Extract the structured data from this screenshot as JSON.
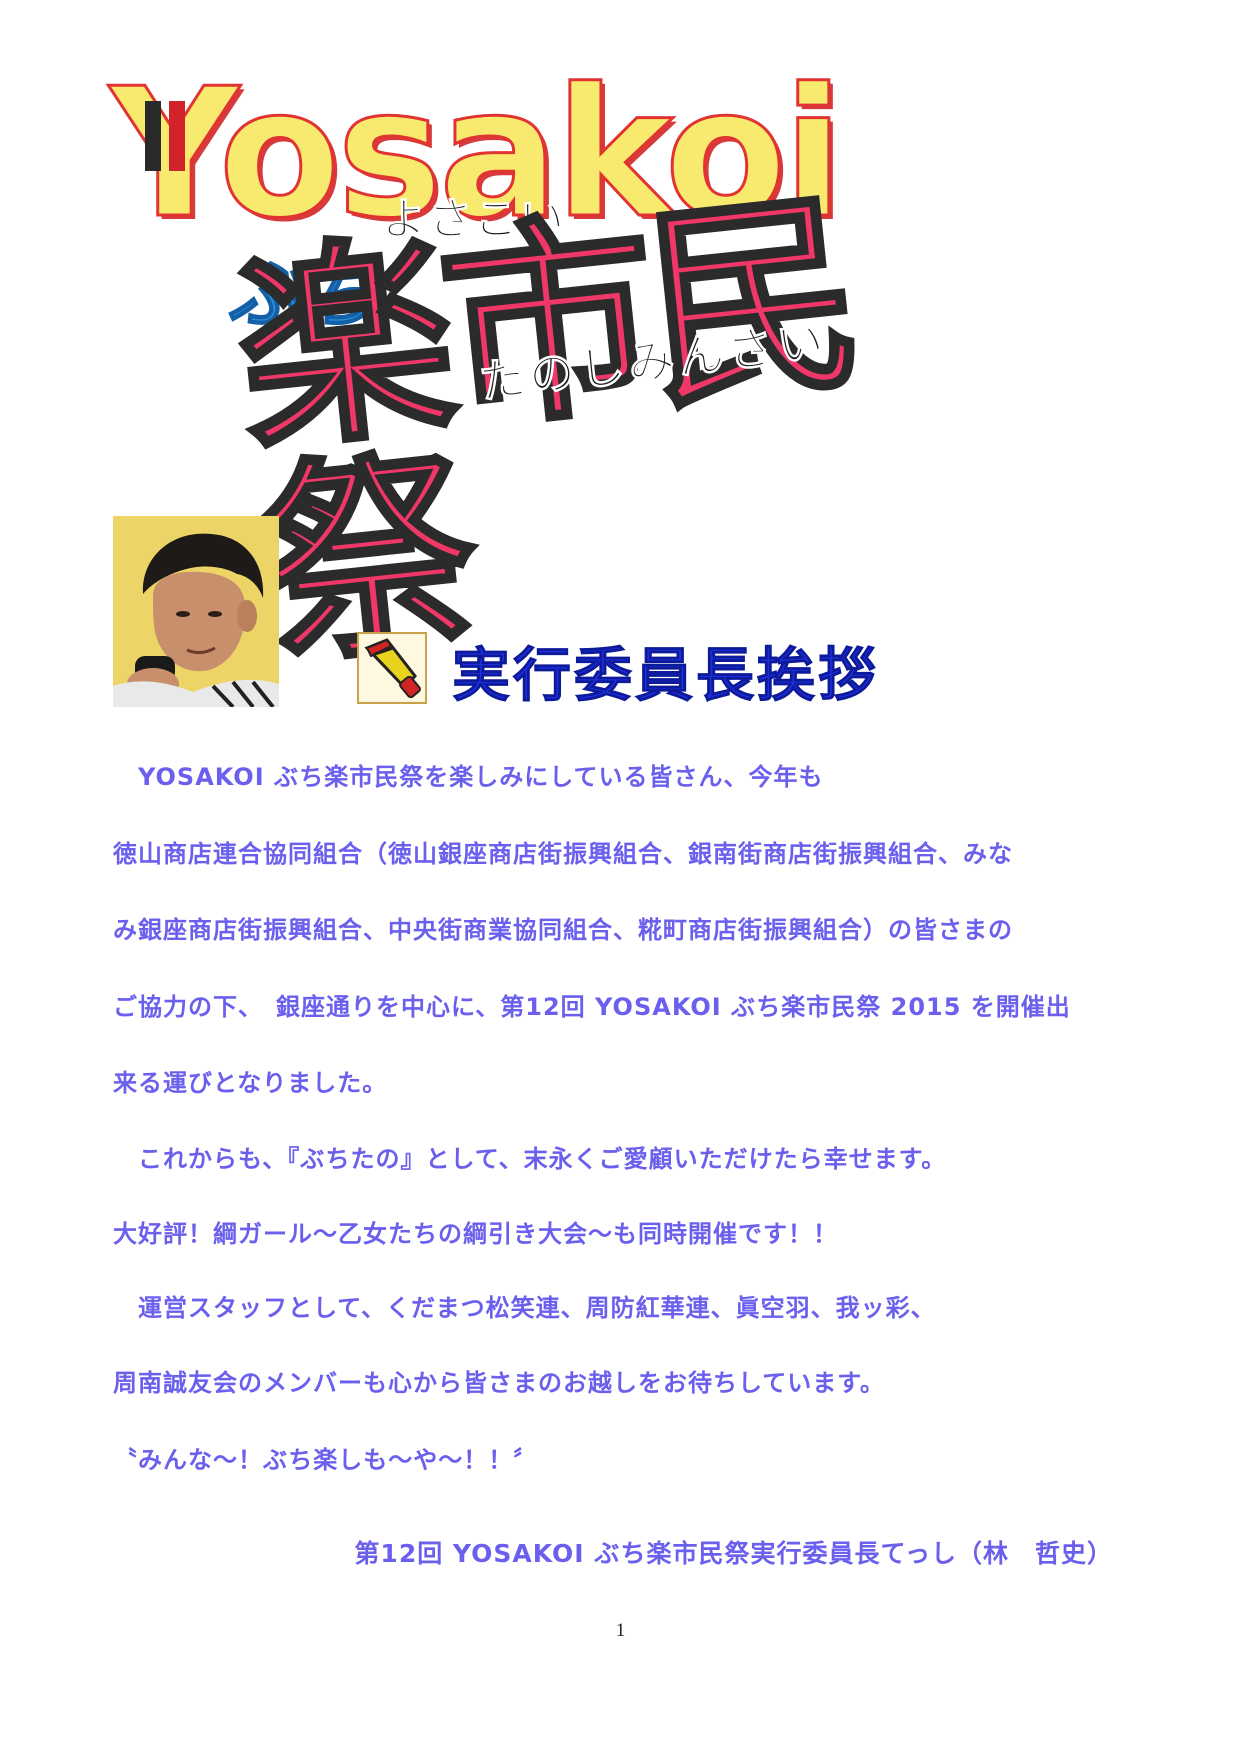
{
  "logo": {
    "main": "Yosakoi",
    "yosakoi_kana": "よさこい",
    "buchi": "ぶち",
    "kanji": "楽市民祭",
    "kana2": "たのしみんさい"
  },
  "heading": {
    "title": "実行委員長挨拶",
    "icon": "megaphone-icon"
  },
  "body": {
    "lines": [
      "　YOSAKOI ぶち楽市民祭を楽しみにしている皆さん、今年も",
      "徳山商店連合協同組合（徳山銀座商店街振興組合、銀南街商店街振興組合、みな",
      "み銀座商店街振興組合、中央街商業協同組合、糀町商店街振興組合）の皆さまの",
      "ご協力の下、　銀座通りを中心に、第12回 YOSAKOI ぶち楽市民祭 2015 を開催出",
      "来る運びとなりました。",
      "　これからも、『ぶちたの』として、末永くご愛顧いただけたら幸せます。",
      "大好評！綱ガール〜乙女たちの綱引き大会〜も同時開催です！！",
      "　運営スタッフとして、くだまつ松笑連、周防紅華連、眞空羽、我ッ彩、",
      "周南誠友会のメンバーも心から皆さまのお越しをお待ちしています。",
      "〝みんな〜！ぶち楽しも〜や〜！！〞"
    ],
    "signature": "第12回 YOSAKOI ぶち楽市民祭実行委員長てっし（林　哲史）"
  },
  "footer": {
    "page_number": "1"
  },
  "colors": {
    "body_text": "#6b60ee",
    "heading": "#1f2fe0",
    "logo_yellow": "#f7ea6e",
    "logo_pink": "#ef3868",
    "logo_blue": "#2a8fd6"
  }
}
